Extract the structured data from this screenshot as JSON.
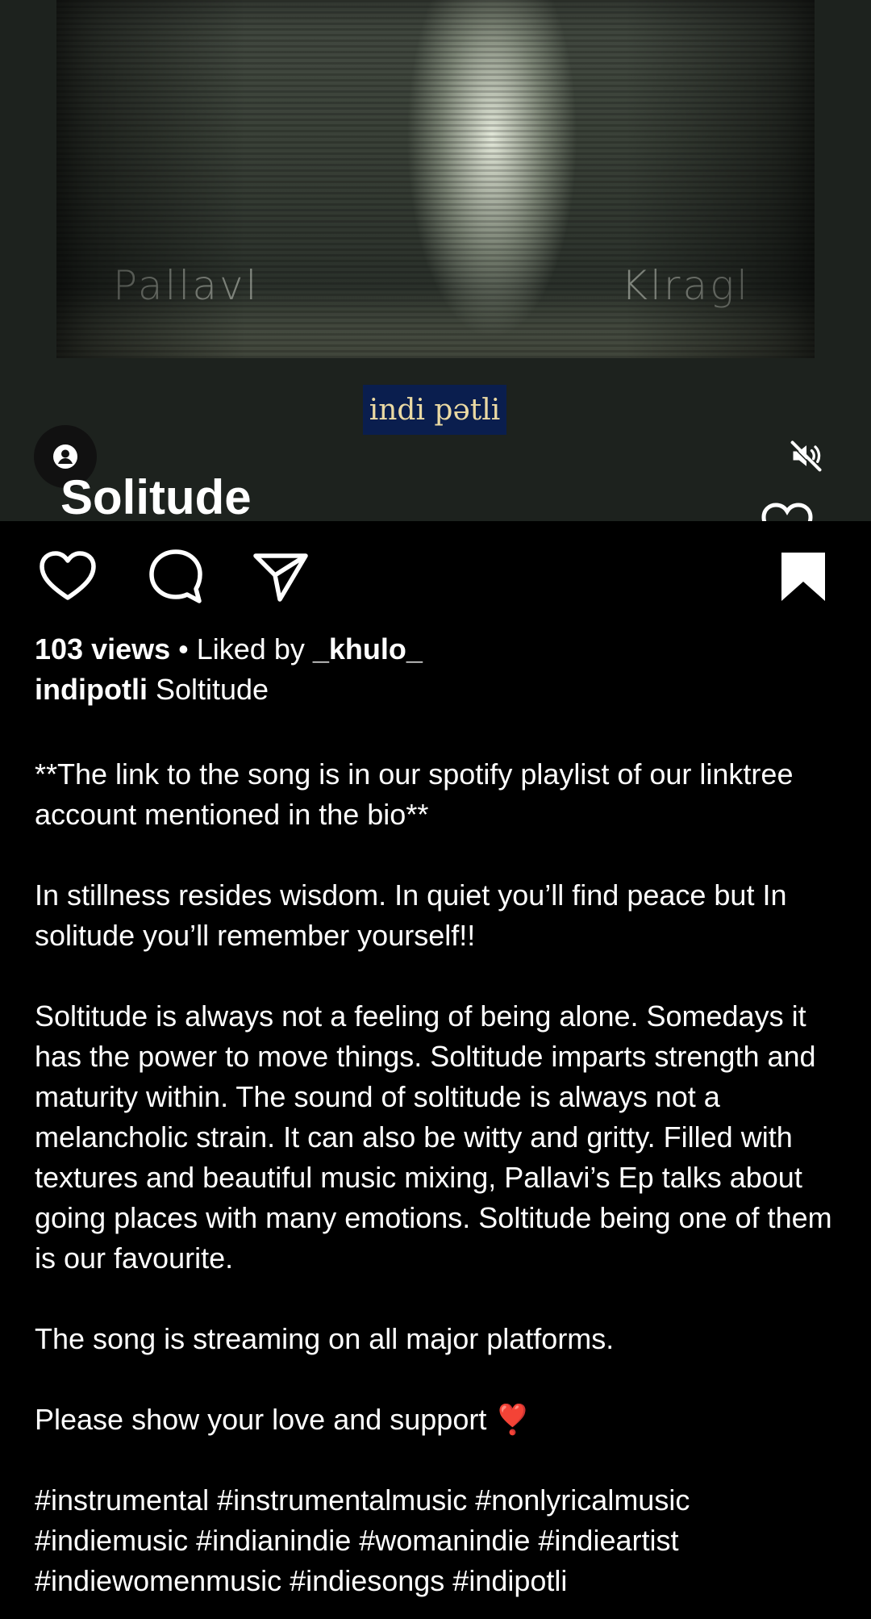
{
  "media": {
    "artist_left": "Pallavl",
    "artist_right": "Klragl",
    "brand": "indi pətli",
    "song_title": "Solitude"
  },
  "icons": {
    "profile": "profile-icon",
    "mute": "volume-muted-icon",
    "like": "heart-icon",
    "comment": "comment-icon",
    "share": "send-icon",
    "save": "bookmark-icon"
  },
  "post": {
    "views": "103 views",
    "separator": " • ",
    "liked_by_prefix": "Liked by ",
    "liked_by_user": "_khulo_",
    "author": "indipotli",
    "caption_title": " Soltitude"
  },
  "caption": {
    "p1": "**The link to the song is in our spotify playlist of our linktree account mentioned in the bio**",
    "p2": "In stillness resides wisdom. In quiet you’ll find peace but In solitude you’ll remember yourself!!",
    "p3": "Soltitude is always not a feeling of being alone. Somedays it has the power to move things. Soltitude imparts strength and maturity within. The sound of soltitude is always not a melancholic strain. It can also be witty and gritty. Filled with textures and beautiful music mixing, Pallavi’s Ep talks about going places with many emotions. Soltitude being one of them is our favourite.",
    "p4": "The song is streaming on all major platforms.",
    "p5": "Please show your love and support ❣️",
    "hashtags": "#instrumental #instrumentalmusic #nonlyricalmusic #indiemusic #indianindie #womanindie #indieartist #indiewomenmusic #indiesongs #indipotli"
  },
  "colors": {
    "background": "#000000",
    "badge_bg": "#0a1e4e",
    "badge_text": "#ead9a3"
  }
}
